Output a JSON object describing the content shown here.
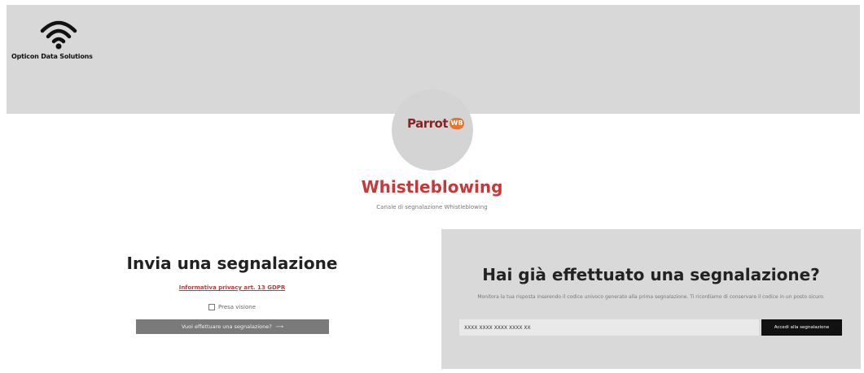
{
  "company": {
    "name": "Opticon Data Solutions",
    "logo_icon": "wifi-icon"
  },
  "brand": {
    "product": "Parrot",
    "badge": "WB",
    "primary_color": "#c8383a"
  },
  "hero": {
    "title": "Whistleblowing",
    "subtitle": "Canale di segnalazione Whistleblowing"
  },
  "report": {
    "title": "Invia una segnalazione",
    "privacy_link": "Informativa privacy art. 13 GDPR",
    "ack_label": "Presa visione",
    "button_label": "Vuoi effettuare una segnalazione?",
    "button_icon": "arrow-right-icon"
  },
  "status": {
    "title": "Hai già effettuato una segnalazione?",
    "description": "Monitora la tua risposta inserendo il codice univoco generato alla prima segnalazione. Ti ricordiamo di conservare il codice in un posto sicuro.",
    "code_placeholder": "XXXX XXXX XXXX XXXX XX",
    "access_button": "Accedi alla segnalazione"
  }
}
